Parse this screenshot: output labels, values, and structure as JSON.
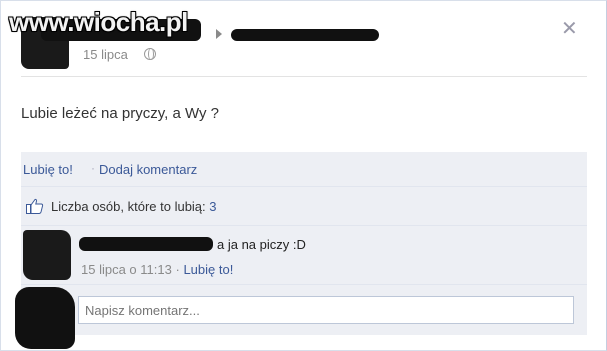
{
  "watermark": "www.wiocha.pl",
  "post": {
    "timestamp": "15 lipca",
    "text": "Lubie leżeć na pryczy, a Wy ?"
  },
  "actions": {
    "like_label": "Lubię to!",
    "separator": "·",
    "comment_label": "Dodaj komentarz"
  },
  "likes": {
    "label": "Liczba osób, które to lubią:",
    "count": "3"
  },
  "comment": {
    "text": "a ja na piczy :D",
    "timestamp": "15 lipca o 11:13",
    "separator": "·",
    "like_label": "Lubię to!"
  },
  "new_comment": {
    "placeholder": "Napisz komentarz..."
  },
  "colors": {
    "link": "#3b5998",
    "panel": "#edeff4"
  }
}
